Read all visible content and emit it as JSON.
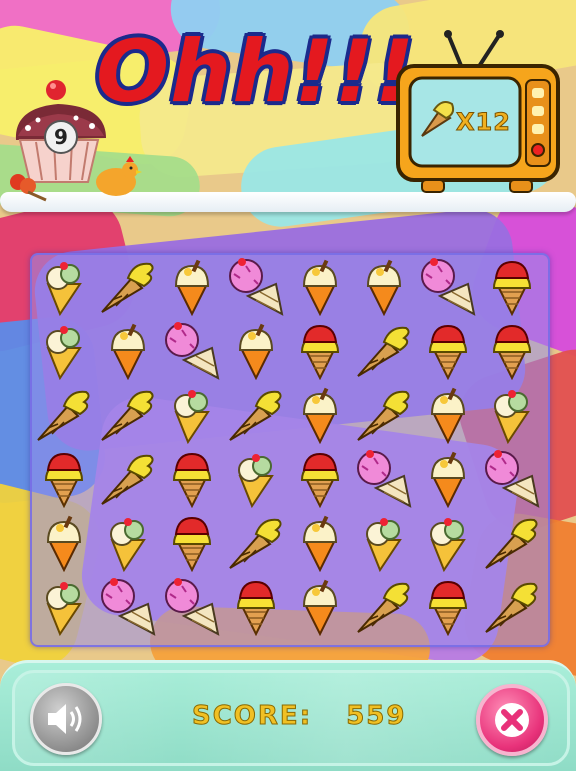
{
  "header": {
    "message": "Ohh!!!",
    "level": "9",
    "target": {
      "icon": "yellow-icecream-cone-icon",
      "count": "X12"
    }
  },
  "board": {
    "rows": [
      [
        "vanilla-pistachio",
        "yellow-swirl",
        "vanilla-orange",
        "pink-sundae",
        "vanilla-orange",
        "vanilla-orange",
        "pink-sundae",
        "strawberry-waffle"
      ],
      [
        "vanilla-pistachio",
        "vanilla-orange",
        "pink-sundae",
        "vanilla-orange",
        "strawberry-waffle",
        "yellow-swirl",
        "strawberry-waffle",
        "strawberry-waffle"
      ],
      [
        "yellow-swirl",
        "yellow-swirl",
        "vanilla-pistachio",
        "yellow-swirl",
        "vanilla-orange",
        "yellow-swirl",
        "vanilla-orange",
        "vanilla-pistachio"
      ],
      [
        "strawberry-waffle",
        "yellow-swirl",
        "strawberry-waffle",
        "vanilla-pistachio",
        "strawberry-waffle",
        "pink-sundae",
        "vanilla-orange",
        "pink-sundae"
      ],
      [
        "vanilla-orange",
        "vanilla-pistachio",
        "strawberry-waffle",
        "yellow-swirl",
        "vanilla-orange",
        "vanilla-pistachio",
        "vanilla-pistachio",
        "yellow-swirl"
      ],
      [
        "vanilla-pistachio",
        "pink-sundae",
        "pink-sundae",
        "strawberry-waffle",
        "vanilla-orange",
        "yellow-swirl",
        "strawberry-waffle",
        "yellow-swirl"
      ]
    ]
  },
  "footer": {
    "score_label": "SCORE:",
    "score_value": "559",
    "sound_icon": "speaker-icon",
    "close_icon": "close-icon"
  },
  "colors": {
    "title_red": "#e4191f",
    "title_outline": "#1b2a8c",
    "score_gold": "#f0c024",
    "footer_mint": "#a9eed9",
    "close_pink": "#e8327a"
  }
}
